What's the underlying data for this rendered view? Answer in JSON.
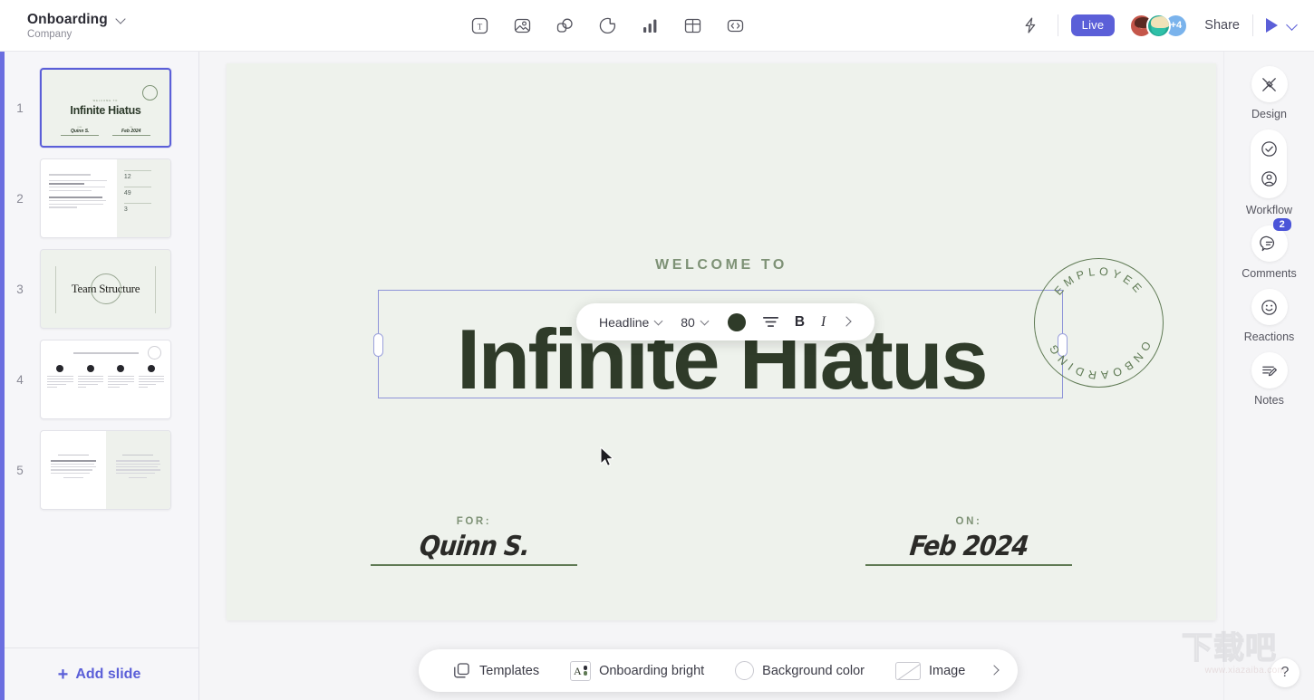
{
  "header": {
    "doc_title": "Onboarding",
    "doc_subtitle": "Company",
    "tools": [
      {
        "name": "text-tool",
        "label": "Text"
      },
      {
        "name": "image-tool",
        "label": "Image"
      },
      {
        "name": "shapes-tool",
        "label": "Shapes"
      },
      {
        "name": "sticker-tool",
        "label": "Sticker"
      },
      {
        "name": "chart-tool",
        "label": "Chart"
      },
      {
        "name": "table-tool",
        "label": "Table"
      },
      {
        "name": "embed-tool",
        "label": "Embed"
      }
    ],
    "live_label": "Live",
    "avatar_overflow": "+4",
    "share_label": "Share"
  },
  "slides_panel": {
    "add_slide_label": "Add slide",
    "slides": [
      {
        "number": "1",
        "title": "Infinite Hiatus",
        "pre": "WELCOME TO",
        "for_label": "FOR:",
        "for_value": "Quinn S.",
        "on_label": "ON:",
        "on_value": "Feb 2024",
        "selected": true
      },
      {
        "number": "2",
        "stats": [
          "12",
          "49",
          "3"
        ],
        "selected": false
      },
      {
        "number": "3",
        "title": "Team Structure",
        "selected": false
      },
      {
        "number": "4",
        "selected": false
      },
      {
        "number": "5",
        "selected": false
      }
    ]
  },
  "slide": {
    "welcome_text": "WELCOME TO",
    "headline": "Infinite Hiatus",
    "stamp_top": "EMPLOYEE",
    "stamp_bottom": "ONBOARDING",
    "for_label": "FOR:",
    "for_value": "Quinn S.",
    "on_label": "ON:",
    "on_value": "Feb 2024"
  },
  "text_toolbar": {
    "style": "Headline",
    "font_size": "80",
    "color": "#2f3b29",
    "bold": "B",
    "italic": "I"
  },
  "bottom_bar": {
    "templates_label": "Templates",
    "theme_label": "Onboarding bright",
    "background_label": "Background color",
    "image_label": "Image"
  },
  "right_rail": [
    {
      "label": "Design",
      "icon": "brush-icon"
    },
    {
      "label": "Workflow",
      "icon": "check-person-icon"
    },
    {
      "label": "Comments",
      "icon": "comment-icon",
      "badge": "2"
    },
    {
      "label": "Reactions",
      "icon": "smiley-icon"
    },
    {
      "label": "Notes",
      "icon": "notes-icon"
    }
  ],
  "help": {
    "label": "?"
  },
  "watermark": {
    "text": "下载吧",
    "url": "www.xiazaiba.com"
  }
}
